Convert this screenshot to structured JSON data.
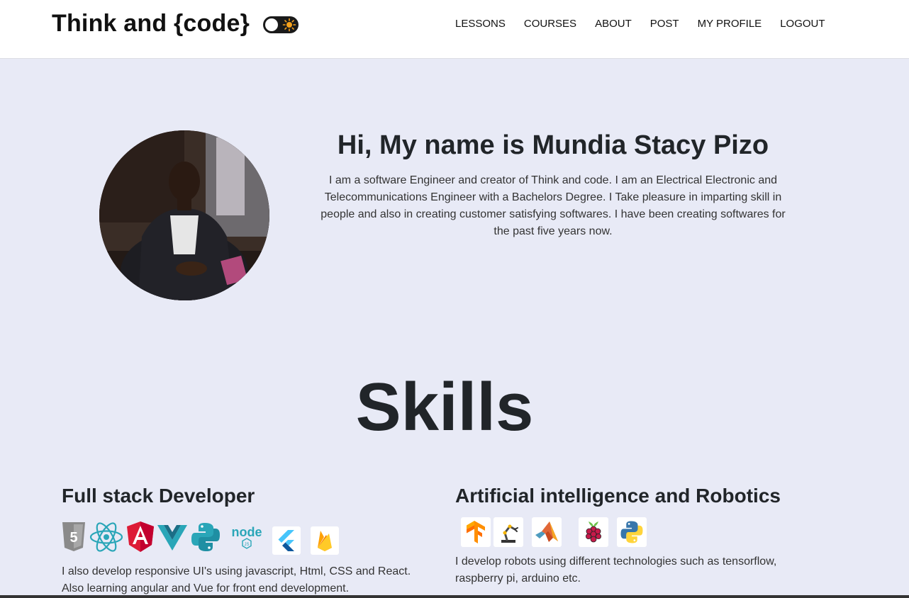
{
  "brand": {
    "title": "Think and {code}"
  },
  "nav": {
    "items": [
      "LESSONS",
      "COURSES",
      "ABOUT",
      "POST",
      "MY PROFILE",
      "LOGOUT"
    ]
  },
  "intro": {
    "title": "Hi, My name is Mundia Stacy Pizo",
    "text": "I am a software Engineer and creator of Think and code. I am an Electrical Electronic and Telecommunications Engineer with a Bachelors Degree. I Take pleasure in imparting skill in people and also in creating customer satisfying softwares. I have been creating softwares for the past five years now."
  },
  "skills": {
    "title": "Skills",
    "full_stack": {
      "title": "Full stack Developer",
      "icons": [
        "html5-icon",
        "react-icon",
        "angular-icon",
        "vue-icon",
        "python-icon",
        "nodejs-icon",
        "flutter-icon",
        "firebase-icon"
      ],
      "text": "I also develop responsive UI's using javascript, Html, CSS and React. Also learning angular and Vue for front end development."
    },
    "ai_robotics": {
      "title": "Artificial intelligence and Robotics",
      "icons": [
        "tensorflow-icon",
        "robot-arm-icon",
        "matlab-icon",
        "raspberry-pi-icon",
        "python-icon"
      ],
      "text": "I develop robots using different technologies such as tensorflow, raspberry pi, arduino etc."
    }
  },
  "colors": {
    "page_background": "#e8eaf6",
    "navbar_background": "#ffffff",
    "text": "#212529"
  }
}
